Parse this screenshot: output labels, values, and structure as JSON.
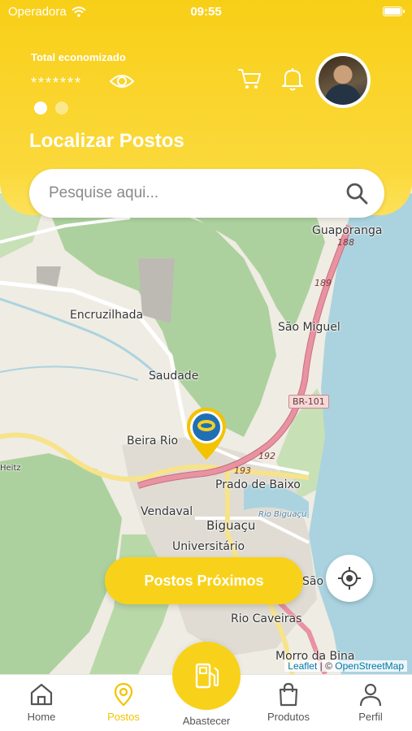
{
  "status_bar": {
    "carrier": "Operadora",
    "time": "09:55"
  },
  "header": {
    "saved_label": "Total economizado",
    "saved_value": "*******",
    "title": "Localizar Postos"
  },
  "search": {
    "placeholder": "Pesquise aqui..."
  },
  "map": {
    "places": [
      "Guaporanga",
      "Encruzilhada",
      "São Miguel",
      "Saudade",
      "Beira Rio",
      "Prado de Baixo",
      "Vendaval",
      "Biguaçu",
      "Universitário",
      "São R",
      "Rio Caveiras",
      "Morro da Bina",
      "Rio Biguaçu",
      "Heitz"
    ],
    "road_shield": "BR-101",
    "road_numbers": [
      "188",
      "189",
      "192",
      "193"
    ],
    "attribution_leaflet": "Leaflet",
    "attribution_sep": " | © ",
    "attribution_osm": "OpenStreetMap"
  },
  "actions": {
    "nearby_label": "Postos Próximos"
  },
  "nav": {
    "items": [
      {
        "label": "Home",
        "icon": "home-icon"
      },
      {
        "label": "Postos",
        "icon": "location-pin-icon",
        "active": true
      },
      {
        "label": "Abastecer",
        "icon": "fuel-pump-icon"
      },
      {
        "label": "Produtos",
        "icon": "shopping-bag-icon"
      },
      {
        "label": "Perfil",
        "icon": "user-icon"
      }
    ]
  },
  "colors": {
    "accent": "#f8d21a",
    "water": "#aad3df",
    "forest": "#add19e",
    "road": "#e892a2"
  }
}
